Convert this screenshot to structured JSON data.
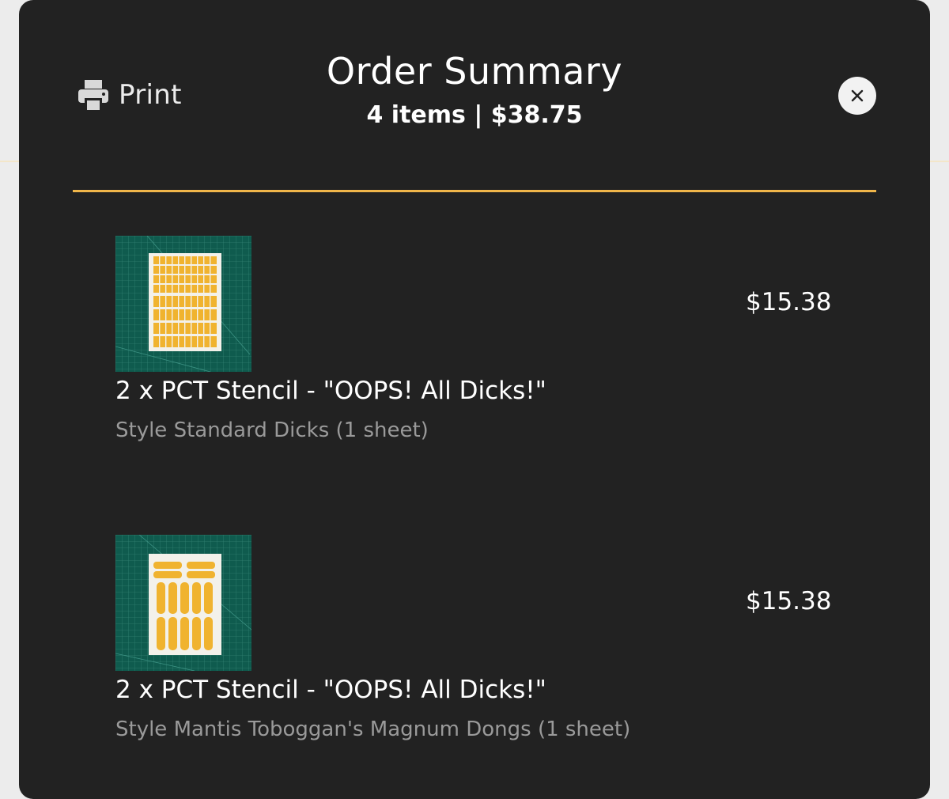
{
  "modal": {
    "print_label": "Print",
    "title": "Order Summary",
    "subtitle": "4 items | $38.75",
    "close_icon": "close-icon",
    "print_icon": "printer-icon"
  },
  "colors": {
    "modal_bg": "#222222",
    "accent_divider": "#f0b64a",
    "stencil_yellow": "#f0b32f",
    "mat_green": "#0f5b4e",
    "muted_text": "#9a9a9a"
  },
  "items": [
    {
      "name": "2 x PCT Stencil - \"OOPS! All Dicks!\"",
      "style": "Style Standard Dicks (1 sheet)",
      "price": "$15.38"
    },
    {
      "name": "2 x PCT Stencil - \"OOPS! All Dicks!\"",
      "style": "Style Mantis Toboggan's Magnum Dongs (1 sheet)",
      "price": "$15.38"
    }
  ]
}
